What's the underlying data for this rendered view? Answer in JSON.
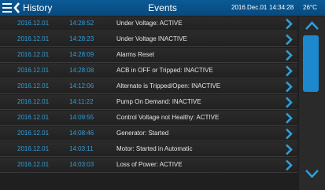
{
  "header": {
    "back_label": "History",
    "title": "Events",
    "date": "2016.Dec.01",
    "time": "14:34:28",
    "temperature": "26°C"
  },
  "events": [
    {
      "date": "2016.12.01",
      "time": "14:28:52",
      "description": "Under Voltage: ACTIVE"
    },
    {
      "date": "2016.12.01",
      "time": "14:28:23",
      "description": "Under Voltage INACTIVE"
    },
    {
      "date": "2016.12.01",
      "time": "14:28:09",
      "description": "Alarms Reset"
    },
    {
      "date": "2016.12.01",
      "time": "14:28:08",
      "description": "ACB in OFF or Tripped: INACTIVE"
    },
    {
      "date": "2016.12.01",
      "time": "14:12:06",
      "description": "Alternate is Tripped/Open: INACTIVE"
    },
    {
      "date": "2016.12.01",
      "time": "14:11:22",
      "description": "Pump On Demand: INACTIVE"
    },
    {
      "date": "2016.12.01",
      "time": "14:09:55",
      "description": "Control Voltage not Healthy: ACTIVE"
    },
    {
      "date": "2016.12.01",
      "time": "14:08:46",
      "description": "Generator: Started"
    },
    {
      "date": "2016.12.01",
      "time": "14:03:11",
      "description": "Motor: Started in Automatic"
    },
    {
      "date": "2016.12.01",
      "time": "14:03:03",
      "description": "Loss of Power: ACTIVE"
    }
  ],
  "icons": {
    "menu": "hamburger-menu-icon",
    "back": "chevron-left-icon",
    "row": "chevron-right-icon",
    "scroll_up": "chevron-up-icon",
    "scroll_down": "chevron-down-icon"
  },
  "colors": {
    "header": "#0b5a96",
    "accent": "#2f9fdc",
    "scroll_thumb": "#1e88cf"
  }
}
